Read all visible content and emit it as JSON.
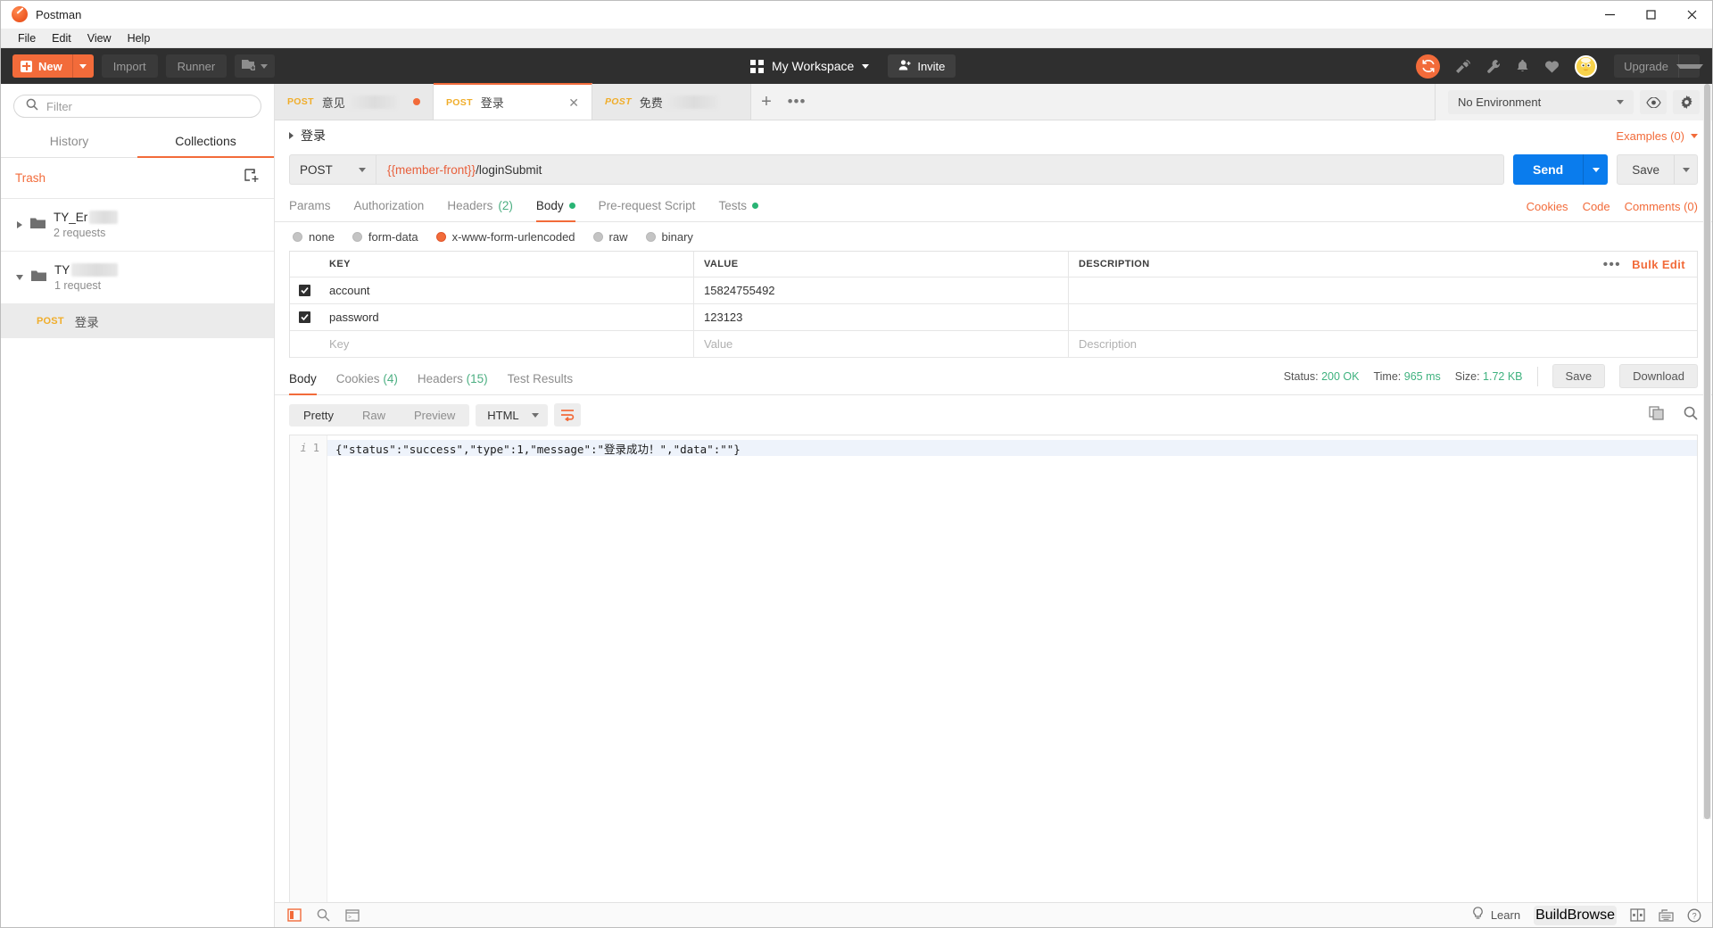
{
  "window": {
    "title": "Postman",
    "logo_icon": "postman-logo-icon",
    "minimize_icon": "minimize-icon",
    "maximize_icon": "maximize-icon",
    "close_icon": "close-icon"
  },
  "menubar": {
    "items": [
      "File",
      "Edit",
      "View",
      "Help"
    ]
  },
  "header": {
    "new_button": "New",
    "import_button": "Import",
    "runner_button": "Runner",
    "new_window_icon": "new-window-icon",
    "grid_icon": "grid-icon",
    "workspace_label": "My Workspace",
    "invite_button": "Invite",
    "invite_icon": "user-add-icon",
    "sync_icon": "sync-icon",
    "interceptor_icon": "satellite-icon",
    "wrench_icon": "wrench-icon",
    "bell_icon": "bell-icon",
    "heart_icon": "heart-icon",
    "avatar_icon": "avatar",
    "upgrade_label": "Upgrade",
    "colors": {
      "accent": "#f26b3a",
      "header_bg": "#2f2f2f",
      "send_blue": "#0a7ced"
    }
  },
  "sidebar": {
    "filter_placeholder": "Filter",
    "search_icon": "search-icon",
    "tabs": [
      {
        "label": "History",
        "active": false
      },
      {
        "label": "Collections",
        "active": true
      }
    ],
    "trash_label": "Trash",
    "new_collection_icon": "new-collection-icon",
    "collections": [
      {
        "name": "TY_Er",
        "redacted": true,
        "requests": "2 requests",
        "expanded": false,
        "folder_icon": "folder-icon"
      },
      {
        "name": "TY",
        "redacted": true,
        "requests": "1 request",
        "expanded": true,
        "folder_icon": "folder-icon"
      }
    ],
    "requests": [
      {
        "method": "POST",
        "name": "登录",
        "selected": true
      }
    ]
  },
  "tabbar": {
    "tabs": [
      {
        "method": "POST",
        "name": "意见",
        "redacted": true,
        "active": false,
        "unsaved": true
      },
      {
        "method": "POST",
        "name": "登录",
        "redacted": false,
        "active": true,
        "unsaved": false,
        "close_icon": "close-icon"
      },
      {
        "method": "POST",
        "name": "免费",
        "redacted": true,
        "active": false,
        "unsaved": false,
        "italic": true
      }
    ],
    "add_tab_icon": "plus-icon",
    "tab_options_icon": "more-options-icon",
    "environment": "No Environment",
    "env_eye_icon": "eye-icon",
    "env_gear_icon": "gear-icon"
  },
  "request": {
    "breadcrumb": "登录",
    "examples_label": "Examples (0)",
    "method": "POST",
    "url_variable": "{{member-front}}",
    "url_path": "/loginSubmit",
    "send_label": "Send",
    "save_label": "Save",
    "tabs": [
      {
        "label": "Params",
        "active": false,
        "count": "",
        "dot": false
      },
      {
        "label": "Authorization",
        "active": false,
        "count": "",
        "dot": false
      },
      {
        "label": "Headers",
        "active": false,
        "count": "(2)",
        "dot": false
      },
      {
        "label": "Body",
        "active": true,
        "count": "",
        "dot": true
      },
      {
        "label": "Pre-request Script",
        "active": false,
        "count": "",
        "dot": false
      },
      {
        "label": "Tests",
        "active": false,
        "count": "",
        "dot": true
      }
    ],
    "links": [
      "Cookies",
      "Code",
      "Comments (0)"
    ],
    "body_types": [
      {
        "label": "none",
        "selected": false
      },
      {
        "label": "form-data",
        "selected": false
      },
      {
        "label": "x-www-form-urlencoded",
        "selected": true
      },
      {
        "label": "raw",
        "selected": false
      },
      {
        "label": "binary",
        "selected": false
      }
    ],
    "table": {
      "headers": [
        "KEY",
        "VALUE",
        "DESCRIPTION"
      ],
      "bulk_edit_label": "Bulk Edit",
      "more_icon": "more-options-icon",
      "rows": [
        {
          "checked": true,
          "key": "account",
          "value": "15824755492",
          "description": ""
        },
        {
          "checked": true,
          "key": "password",
          "value": "123123",
          "description": ""
        }
      ],
      "placeholder_row": {
        "key": "Key",
        "value": "Value",
        "description": "Description"
      }
    }
  },
  "response": {
    "tabs": [
      {
        "label": "Body",
        "count": "",
        "active": true
      },
      {
        "label": "Cookies",
        "count": "(4)",
        "active": false
      },
      {
        "label": "Headers",
        "count": "(15)",
        "active": false
      },
      {
        "label": "Test Results",
        "count": "",
        "active": false
      }
    ],
    "status_label": "Status:",
    "status_value": "200 OK",
    "time_label": "Time:",
    "time_value": "965 ms",
    "size_label": "Size:",
    "size_value": "1.72 KB",
    "save_button": "Save",
    "download_button": "Download",
    "viewer_modes": [
      {
        "label": "Pretty",
        "active": true
      },
      {
        "label": "Raw",
        "active": false
      },
      {
        "label": "Preview",
        "active": false
      }
    ],
    "format": "HTML",
    "wrap_icon": "wrap-lines-icon",
    "copy_icon": "copy-icon",
    "search_icon": "search-icon",
    "line_number": "1",
    "info_icon": "info-icon",
    "body_text": "{\"status\":\"success\",\"type\":1,\"message\":\"登录成功！\",\"data\":\"\"}"
  },
  "footer": {
    "sidebar_toggle_icon": "sidebar-toggle-icon",
    "find_icon": "search-icon",
    "console_icon": "console-icon",
    "learn_label": "Learn",
    "bulb_icon": "lightbulb-icon",
    "modes": [
      {
        "label": "Build",
        "active": true
      },
      {
        "label": "Browse",
        "active": false
      }
    ],
    "two_pane_icon": "two-pane-icon",
    "keyboard_icon": "keyboard-icon",
    "help_icon": "help-icon"
  }
}
